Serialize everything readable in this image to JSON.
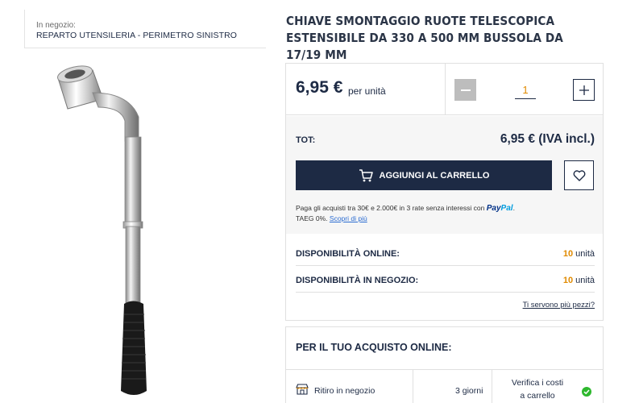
{
  "store": {
    "label": "In negozio:",
    "location": "REPARTO UTENSILERIA - PERIMETRO SINISTRO"
  },
  "product": {
    "title": "CHIAVE SMONTAGGIO RUOTE TELESCOPICA ESTENSIBILE DA 330 A 500 MM BUSSOLA DA 17/19 MM",
    "image": "telescopic-wheel-wrench"
  },
  "pricing": {
    "price": "6,95 €",
    "per_unit": "per unità",
    "quantity": "1",
    "minus_icon": "minus-icon",
    "plus_icon": "plus-icon"
  },
  "total": {
    "label": "TOT:",
    "value": "6,95 € (IVA incl.)"
  },
  "cart": {
    "add_label": "AGGIUNGI AL CARRELLO",
    "cart_icon": "cart-icon",
    "wishlist_icon": "heart-icon"
  },
  "paypal": {
    "text": "Paga gli acquisti tra 30€ e 2.000€ in 3 rate senza interessi con",
    "logo_part1": "Pay",
    "logo_part2": "Pal",
    "after_logo": ".",
    "taeg": "TAEG 0%.",
    "link": "Scopri di più"
  },
  "availability": [
    {
      "label": "DISPONIBILITÀ ONLINE:",
      "count": "10",
      "unit": "unità"
    },
    {
      "label": "DISPONIBILITÀ IN NEGOZIO:",
      "count": "10",
      "unit": "unità"
    }
  ],
  "need_more_link": "Ti servono più pezzi?",
  "online_purchase": {
    "title": "PER IL TUO ACQUISTO ONLINE:",
    "pickup_label": "Ritiro in negozio",
    "pickup_days": "3 giorni",
    "cost_line1": "Verifica i costi",
    "cost_line2": "a carrello",
    "store_icon": "store-icon",
    "check_icon": "check-circle-icon"
  },
  "colors": {
    "primary": "#1d2a44",
    "accent": "#e08a00",
    "success": "#2eb82e"
  }
}
